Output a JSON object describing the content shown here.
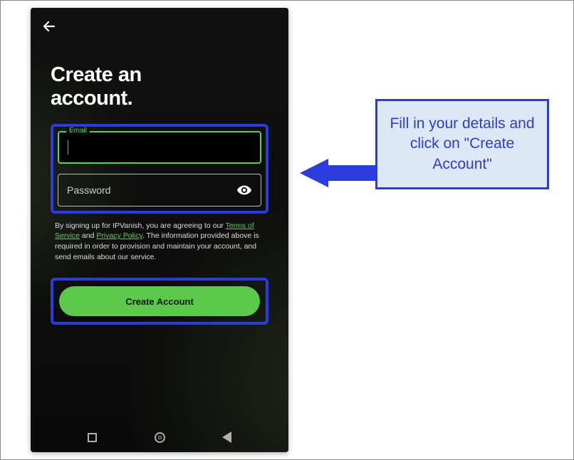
{
  "title": "Create an account.",
  "fields": {
    "email_label": "Email",
    "password_placeholder": "Password"
  },
  "legal": {
    "prefix": "By signing up for IPVanish, you are agreeing to our ",
    "tos": "Terms of Service",
    "and": " and ",
    "privacy": "Privacy Policy",
    "suffix": ". The information provided above is required in order to provision and maintain your account, and send emails about our service."
  },
  "button": {
    "create": "Create Account"
  },
  "callout": "Fill in your details and click on \"Create Account\""
}
